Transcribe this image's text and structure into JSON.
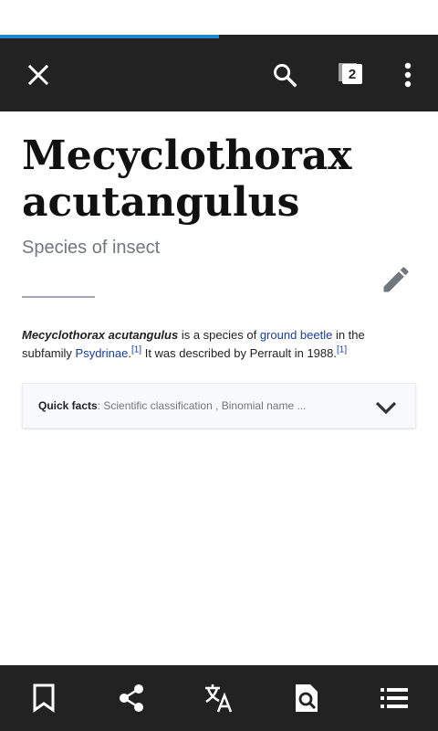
{
  "progress": {
    "value_percent": 50,
    "color": "#1e88c9"
  },
  "toolbar": {
    "tab_count": "2",
    "icons": [
      "close-icon",
      "search-icon",
      "tabs-icon",
      "overflow-menu-icon"
    ]
  },
  "article": {
    "title": "Mecyclothorax acutangulus",
    "description": "Species of insect",
    "summary": {
      "bold_name": "Mecyclothorax acutangulus",
      "text1": " is a species of ",
      "link1": "ground beetle",
      "text2": " in the subfamily ",
      "link2": "Psydrinae",
      "text3": ".",
      "ref1": "[1]",
      "text4": " It was described by Perrault in 1988.",
      "ref2": "[1]"
    }
  },
  "quick_facts": {
    "label": "Quick facts",
    "separator": ": ",
    "summary": "Scientific classification , Binomial name ..."
  },
  "bottom_bar": {
    "icons": [
      "bookmark-icon",
      "share-icon",
      "translate-icon",
      "find-in-page-icon",
      "table-of-contents-icon"
    ]
  },
  "colors": {
    "toolbar_bg": "#222222",
    "link": "#1a3e99",
    "description": "#72777d"
  }
}
